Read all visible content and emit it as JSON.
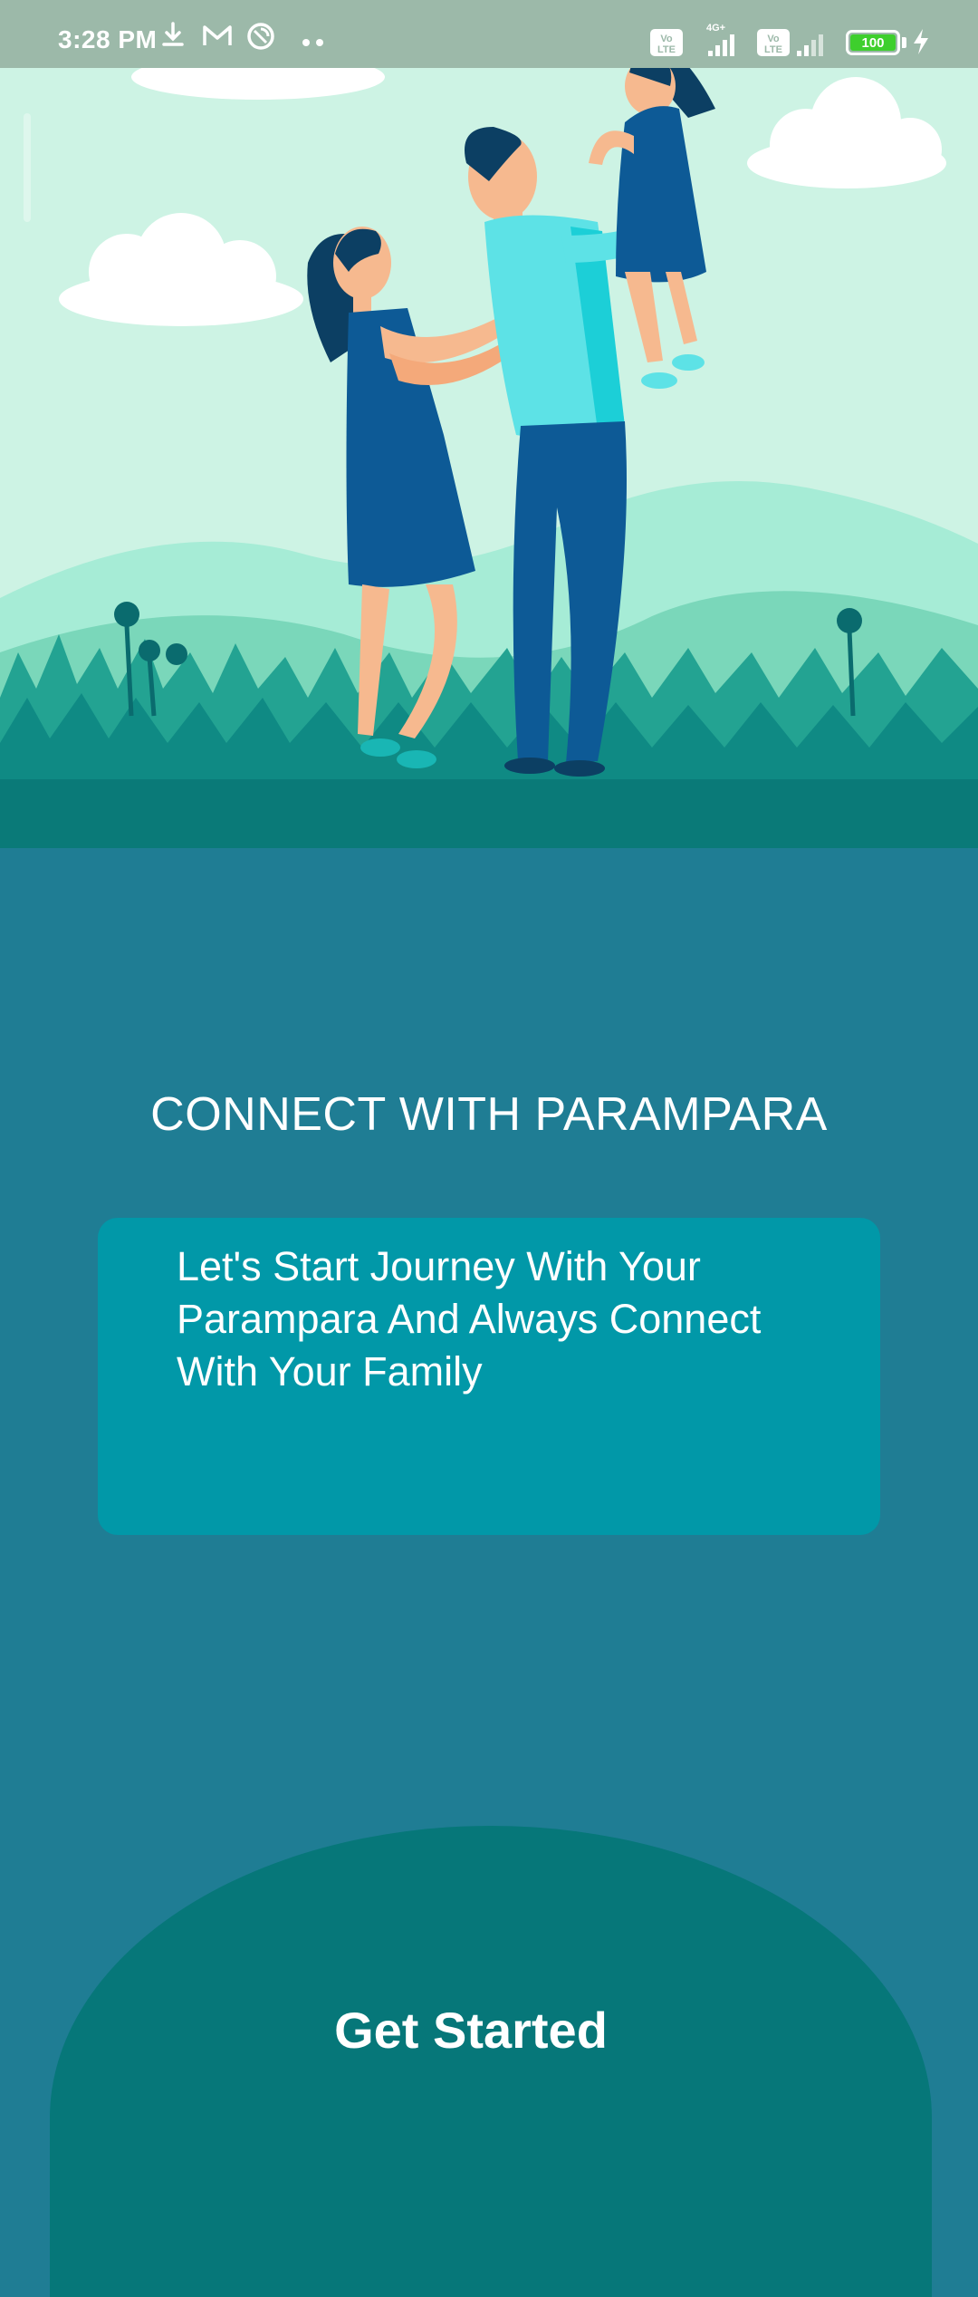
{
  "status_bar": {
    "time": "3:28 PM",
    "battery_level": "100",
    "icons": [
      "download-icon",
      "gmail-icon",
      "vpn-icon",
      "more-dots-icon",
      "volte-icon",
      "signal-icon",
      "charging-icon"
    ]
  },
  "main": {
    "title": "CONNECT WITH PARAMPARA",
    "description": "Let's Start Journey With Your Parampara And Always Connect With Your Family",
    "cta_label": "Get Started"
  },
  "colors": {
    "background": "#1f7d94",
    "card": "#0198a8",
    "arc": "#067779",
    "hero_sky": "#cdf3e4",
    "grass": "#0a7a78"
  }
}
